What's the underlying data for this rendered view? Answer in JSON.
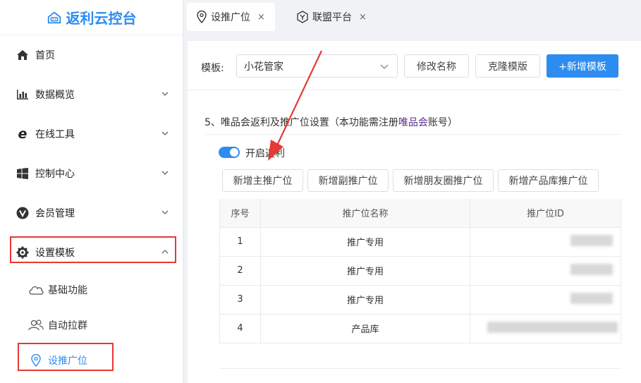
{
  "app": {
    "logo_text": "返利云控台"
  },
  "sidebar": {
    "items": [
      {
        "label": "首页",
        "icon": "home-icon"
      },
      {
        "label": "数据概览",
        "icon": "bar-chart-icon"
      },
      {
        "label": "在线工具",
        "icon": "ie-icon"
      },
      {
        "label": "控制中心",
        "icon": "windows-icon"
      },
      {
        "label": "会员管理",
        "icon": "member-icon"
      },
      {
        "label": "设置模板",
        "icon": "gear-icon"
      }
    ],
    "sub_items": [
      {
        "label": "基础功能",
        "icon": "cloud-icon"
      },
      {
        "label": "自动拉群",
        "icon": "group-icon"
      },
      {
        "label": "设推广位",
        "icon": "location-pin-icon"
      }
    ]
  },
  "tabs": [
    {
      "label": "设推广位",
      "close": "×"
    },
    {
      "label": "联盟平台",
      "close": "×"
    }
  ],
  "toolbar": {
    "template_label": "模板:",
    "template_value": "小花管家",
    "rename_label": "修改名称",
    "clone_label": "克隆模版",
    "add_label": "+新增模板"
  },
  "section": {
    "title_prefix": "5、唯品会返利及推广位设置（本功能需注册",
    "title_highlight": "唯品会",
    "title_suffix": "账号）",
    "toggle_label": "开启返利",
    "toggle_on": true
  },
  "actions": {
    "add_main": "新增主推广位",
    "add_sub": "新增副推广位",
    "add_moments": "新增朋友圈推广位",
    "add_product": "新增产品库推广位"
  },
  "table": {
    "headers": [
      "序号",
      "推广位名称",
      "推广位ID"
    ],
    "rows": [
      {
        "no": "1",
        "name": "推广专用"
      },
      {
        "no": "2",
        "name": "推广专用"
      },
      {
        "no": "3",
        "name": "推广专用"
      },
      {
        "no": "4",
        "name": "产品库"
      }
    ]
  },
  "colors": {
    "accent": "#2d8cf0",
    "highlight_box": "#e53935",
    "vip_text": "#5a2d8c"
  }
}
